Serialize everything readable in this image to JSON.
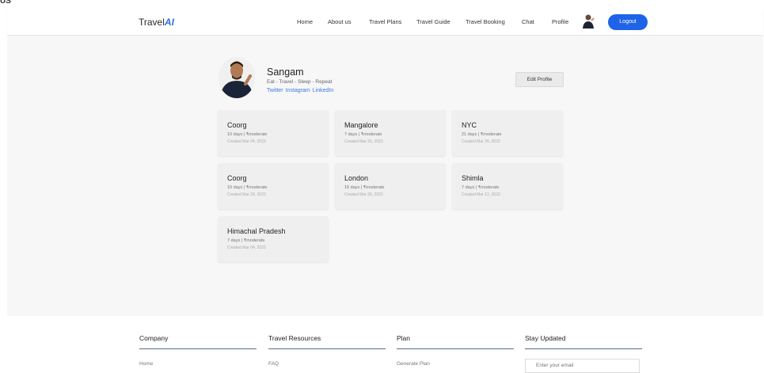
{
  "app": {
    "corner_label": "US",
    "logo_prefix": "Travel",
    "logo_accent": "AI"
  },
  "nav": {
    "items": [
      "Home",
      "About us",
      "Travel Plans",
      "Travel Guide",
      "Travel Booking",
      "Chat",
      "Profile"
    ],
    "logout_label": "Logout"
  },
  "profile": {
    "name": "Sangam",
    "tagline": "Eat - Travel - Sleep - Repeat",
    "links": [
      "Twitter",
      "Instagram",
      "LinkedIn"
    ],
    "edit_label": "Edit Profile"
  },
  "plans": [
    {
      "title": "Coorg",
      "meta": "10 days | ₹moderate",
      "created": "Created Mar 04, 2023"
    },
    {
      "title": "Mangalore",
      "meta": "7 days | ₹moderate",
      "created": "Created Mar 26, 2023"
    },
    {
      "title": "NYC",
      "meta": "21 days | ₹moderate",
      "created": "Created Mar 26, 2023"
    },
    {
      "title": "Coorg",
      "meta": "10 days | ₹moderate",
      "created": "Created Mar 28, 2023"
    },
    {
      "title": "London",
      "meta": "15 days | ₹moderate",
      "created": "Created Mar 26, 2023"
    },
    {
      "title": "Shimla",
      "meta": "7 days | ₹moderate",
      "created": "Created Mar 13, 2023"
    },
    {
      "title": "Himachal Pradesh",
      "meta": "7 days | ₹moderate",
      "created": "Created Mar 04, 2023"
    }
  ],
  "footer": {
    "columns": [
      {
        "heading": "Company",
        "first_link": "Home"
      },
      {
        "heading": "Travel Resources",
        "first_link": "FAQ"
      },
      {
        "heading": "Plan",
        "first_link": "Generate Plan"
      },
      {
        "heading": "Stay Updated",
        "first_link": ""
      }
    ],
    "email_placeholder": "Enter your email"
  },
  "colors": {
    "accent": "#1e63e8",
    "link": "#3a7be0",
    "page_bg": "#f7f7f8"
  }
}
